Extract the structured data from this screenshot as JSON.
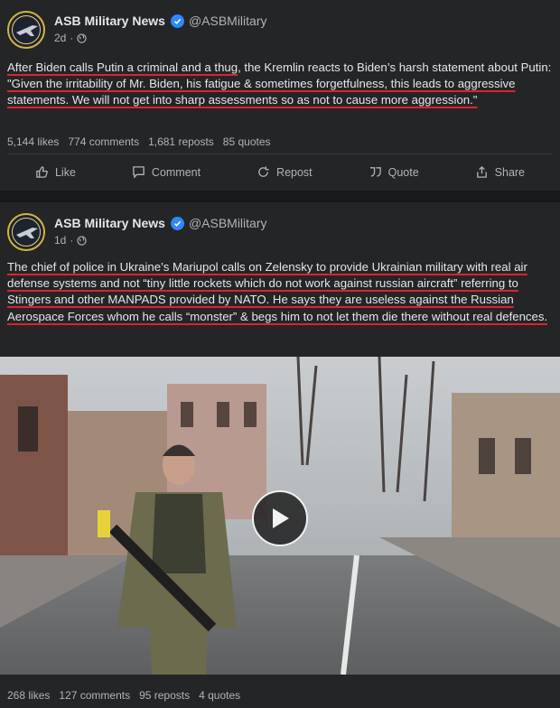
{
  "posts": [
    {
      "author_name": "ASB Military News",
      "author_handle": "@ASBMilitary",
      "time": "2d",
      "text_segments": [
        {
          "t": "After Biden calls Putin a criminal and a thug",
          "u": true
        },
        {
          "t": ", the Kremlin reacts to Biden’s harsh statement about Putin:",
          "u": false
        },
        {
          "br": true
        },
        {
          "t": "\"Given the irritability of Mr. Biden, his fatigue & sometimes forgetfulness, this leads to aggressive statements. We will not get into sharp assessments so as not to cause more aggression.\"",
          "u": true
        }
      ],
      "stats": {
        "likes": "5,144 likes",
        "comments": "774 comments",
        "reposts": "1,681 reposts",
        "quotes": "85 quotes"
      },
      "actions": {
        "like": "Like",
        "comment": "Comment",
        "repost": "Repost",
        "quote": "Quote",
        "share": "Share"
      }
    },
    {
      "author_name": "ASB Military News",
      "author_handle": "@ASBMilitary",
      "time": "1d",
      "text_segments": [
        {
          "t": "The chief of police in Ukraine’s Mariupol calls on Zelensky to provide Ukrainian military with real air defense systems and not “tiny little rockets which do not work against russian aircraft” referring to Stingers and other MANPADS provided by NATO. He says they are useless against the Russian Aerospace Forces whom he calls “monster” & begs him to not let them die there without real defences.",
          "u": true
        }
      ],
      "stats": {
        "likes": "268 likes",
        "comments": "127 comments",
        "reposts": "95 reposts",
        "quotes": "4 quotes"
      }
    }
  ],
  "colors": {
    "background": "#242526",
    "separator": "#18191a",
    "underline": "#e0212f",
    "verified": "#2d88ff"
  },
  "icons": [
    "globe-icon",
    "verified-badge-icon",
    "like-icon",
    "comment-icon",
    "repost-icon",
    "quote-icon",
    "share-icon",
    "play-icon"
  ]
}
